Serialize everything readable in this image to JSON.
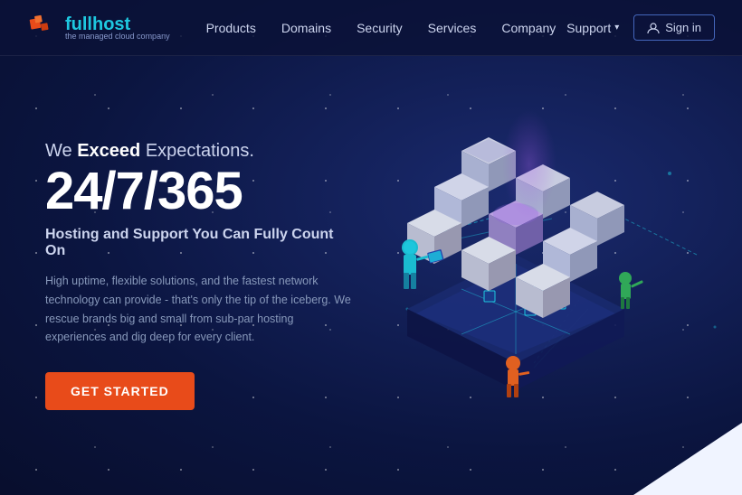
{
  "nav": {
    "logo_text_normal": "full",
    "logo_text_accent": "host",
    "logo_sub": "the managed cloud company",
    "links": [
      {
        "label": "Products",
        "id": "products"
      },
      {
        "label": "Domains",
        "id": "domains"
      },
      {
        "label": "Security",
        "id": "security"
      },
      {
        "label": "Services",
        "id": "services"
      },
      {
        "label": "Company",
        "id": "company"
      }
    ],
    "support_label": "Support",
    "signin_label": "Sign in"
  },
  "hero": {
    "tagline_prefix": "We ",
    "tagline_bold": "Exceed",
    "tagline_suffix": " Expectations.",
    "big_number": "24/7/365",
    "subtitle": "Hosting and Support You Can Fully Count On",
    "description": "High uptime, flexible solutions, and the fastest network technology can provide - that's only the tip of the iceberg. We rescue brands big and small from sub-par hosting experiences and dig deep for every client.",
    "cta_label": "GET STARTED"
  },
  "colors": {
    "accent_orange": "#e84b1a",
    "accent_teal": "#1ec8e0",
    "accent_purple": "#9b6ff0",
    "nav_bg": "rgba(10,18,55,0.85)",
    "body_bg": "#0b1540"
  }
}
